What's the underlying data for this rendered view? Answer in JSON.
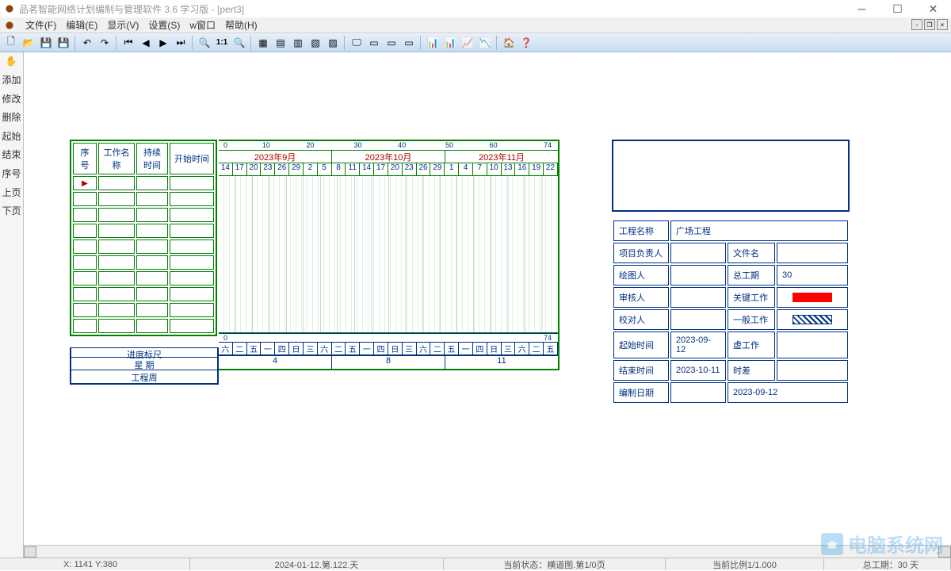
{
  "title": "品茗智能网络计划编制与管理软件 3.6 学习版 - [pert3]",
  "menu": {
    "file": "文件(F)",
    "edit": "编辑(E)",
    "view": "显示(V)",
    "settings": "设置(S)",
    "window": "w窗口",
    "help": "帮助(H)"
  },
  "sidebar": {
    "items": [
      "添加",
      "修改",
      "删除",
      "起始",
      "结束",
      "序号",
      "上页",
      "下页"
    ]
  },
  "task_table": {
    "headers": [
      "序号",
      "工作名称",
      "持续时间",
      "开始时间"
    ]
  },
  "gantt": {
    "scale_ticks": [
      "0",
      "10",
      "20",
      "30",
      "40",
      "50",
      "60",
      "74"
    ],
    "scale_end": "74",
    "months": [
      "2023年9月",
      "2023年10月",
      "2023年11月"
    ],
    "days": [
      "14",
      "17",
      "20",
      "23",
      "26",
      "29",
      "2",
      "5",
      "8",
      "11",
      "14",
      "17",
      "20",
      "23",
      "26",
      "29",
      "1",
      "4",
      "7",
      "10",
      "13",
      "16",
      "19",
      "22"
    ],
    "bottom_weekdays": [
      "六",
      "二",
      "五",
      "一",
      "四",
      "日",
      "三",
      "六",
      "二",
      "五",
      "一",
      "四",
      "日",
      "三",
      "六",
      "二",
      "五",
      "一",
      "四",
      "日",
      "三",
      "六",
      "二",
      "五"
    ],
    "weeks": [
      "4",
      "8",
      "11"
    ],
    "bottom_scale_end": "74",
    "labels": {
      "progress": "进度标尺",
      "weekday": "星 期",
      "week": "工程周"
    }
  },
  "info": {
    "project_name_lbl": "工程名称",
    "project_name": "广场工程",
    "owner_lbl": "项目负责人",
    "owner": "",
    "file_lbl": "文件名",
    "file": "",
    "drawer_lbl": "绘图人",
    "drawer": "",
    "duration_lbl": "总工期",
    "duration": "30",
    "reviewer_lbl": "审核人",
    "reviewer": "",
    "critical_lbl": "关键工作",
    "checker_lbl": "校对人",
    "checker": "",
    "normal_lbl": "一般工作",
    "start_lbl": "起始时间",
    "start": "2023-09-12",
    "virtual_lbl": "虚工作",
    "end_lbl": "结束时间",
    "end": "2023-10-11",
    "float_lbl": "时差",
    "compile_lbl": "编制日期",
    "compile": "2023-09-12"
  },
  "status": {
    "coords": "X: 1141  Y:380",
    "date": "2024-01-12.第.122.天",
    "state": "当前状态：横道图.第1/0页",
    "ratio": "当前比例1/1.000",
    "total": "总工期：30 天"
  },
  "watermark": "电脑系统网"
}
